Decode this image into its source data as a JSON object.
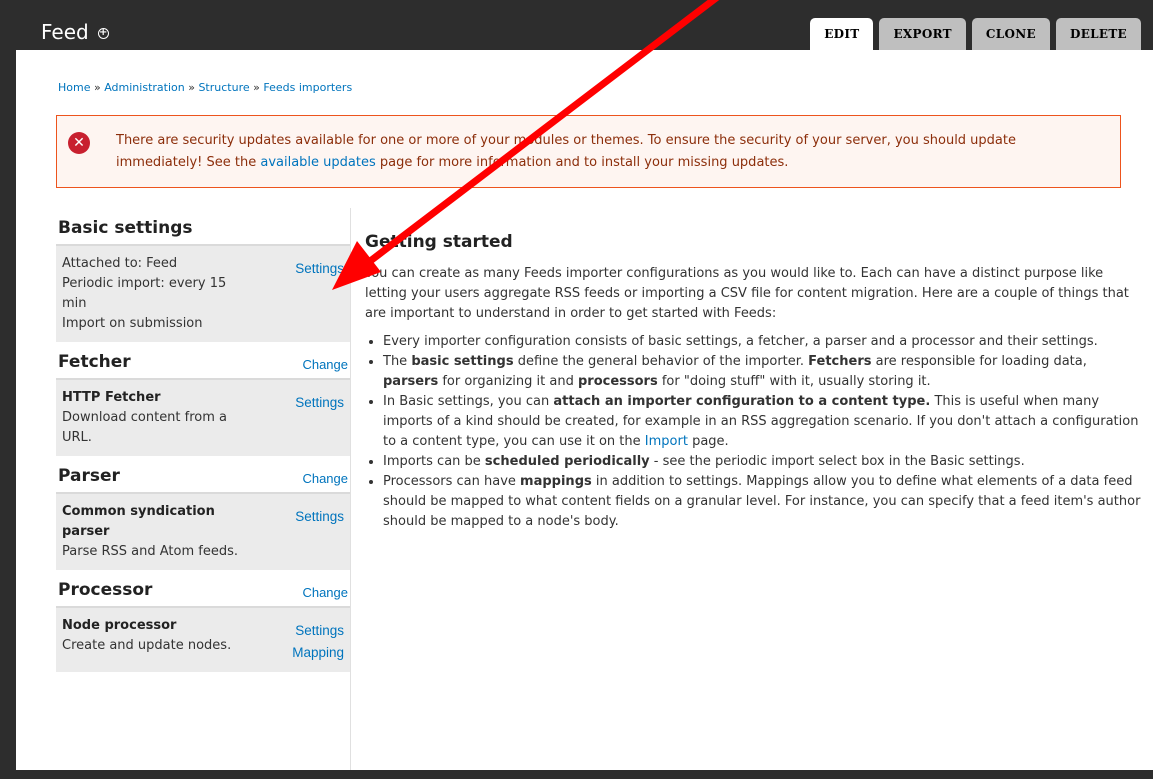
{
  "header": {
    "site_title": "Feed",
    "tabs": [
      "EDIT",
      "EXPORT",
      "CLONE",
      "DELETE"
    ]
  },
  "breadcrumb": [
    "Home",
    "Administration",
    "Structure",
    "Feeds importers"
  ],
  "breadcrumb_sep": "»",
  "alert": {
    "text_1": "There are security updates available for one or more of your modules or themes. To ensure the security of your server, you should update immediately! See the ",
    "link": "available updates",
    "text_2": " page for more information and to install your missing updates."
  },
  "sidebar": {
    "basic": {
      "title": "Basic settings",
      "lines": [
        "Attached to: Feed",
        "Periodic import: every 15 min",
        "Import on submission"
      ],
      "action": "Settings"
    },
    "fetcher": {
      "title": "Fetcher",
      "change": "Change",
      "name": "HTTP Fetcher",
      "desc": "Download content from a URL.",
      "action": "Settings"
    },
    "parser": {
      "title": "Parser",
      "change": "Change",
      "name": "Common syndication parser",
      "desc": "Parse RSS and Atom feeds.",
      "action": "Settings"
    },
    "processor": {
      "title": "Processor",
      "change": "Change",
      "name": "Node processor",
      "desc": "Create and update nodes.",
      "action": "Settings",
      "action2": "Mapping"
    }
  },
  "main": {
    "title": "Getting started",
    "intro": "You can create as many Feeds importer configurations as you would like to. Each can have a distinct purpose like letting your users aggregate RSS feeds or importing a CSV file for content migration. Here are a couple of things that are important to understand in order to get started with Feeds:",
    "b1": "Every importer configuration consists of basic settings, a fetcher, a parser and a processor and their settings.",
    "b2_pre": "The ",
    "b2_s1": "basic settings",
    "b2_t1": " define the general behavior of the importer. ",
    "b2_s2": "Fetchers",
    "b2_t2": " are responsible for loading data, ",
    "b2_s3": "parsers",
    "b2_t3": " for organizing it and ",
    "b2_s4": "processors",
    "b2_t4": " for \"doing stuff\" with it, usually storing it.",
    "b3_pre": "In Basic settings, you can ",
    "b3_s1": "attach an importer configuration to a content type.",
    "b3_t1": " This is useful when many imports of a kind should be created, for example in an RSS aggregation scenario. If you don't attach a configuration to a content type, you can use it on the ",
    "b3_link": "Import",
    "b3_t2": " page.",
    "b4_pre": "Imports can be ",
    "b4_s1": "scheduled periodically",
    "b4_t1": " - see the periodic import select box in the Basic settings.",
    "b5_pre": "Processors can have ",
    "b5_s1": "mappings",
    "b5_t1": " in addition to settings. Mappings allow you to define what elements of a data feed should be mapped to what content fields on a granular level. For instance, you can specify that a feed item's author should be mapped to a node's body."
  },
  "colors": {
    "arrow": "#ff0000",
    "link": "#0074bd",
    "alert_border": "#ed541d",
    "alert_bg": "#fef5f1"
  },
  "icons": {
    "title_icon": "plus-circle-icon",
    "alert_icon": "error-x-icon"
  }
}
